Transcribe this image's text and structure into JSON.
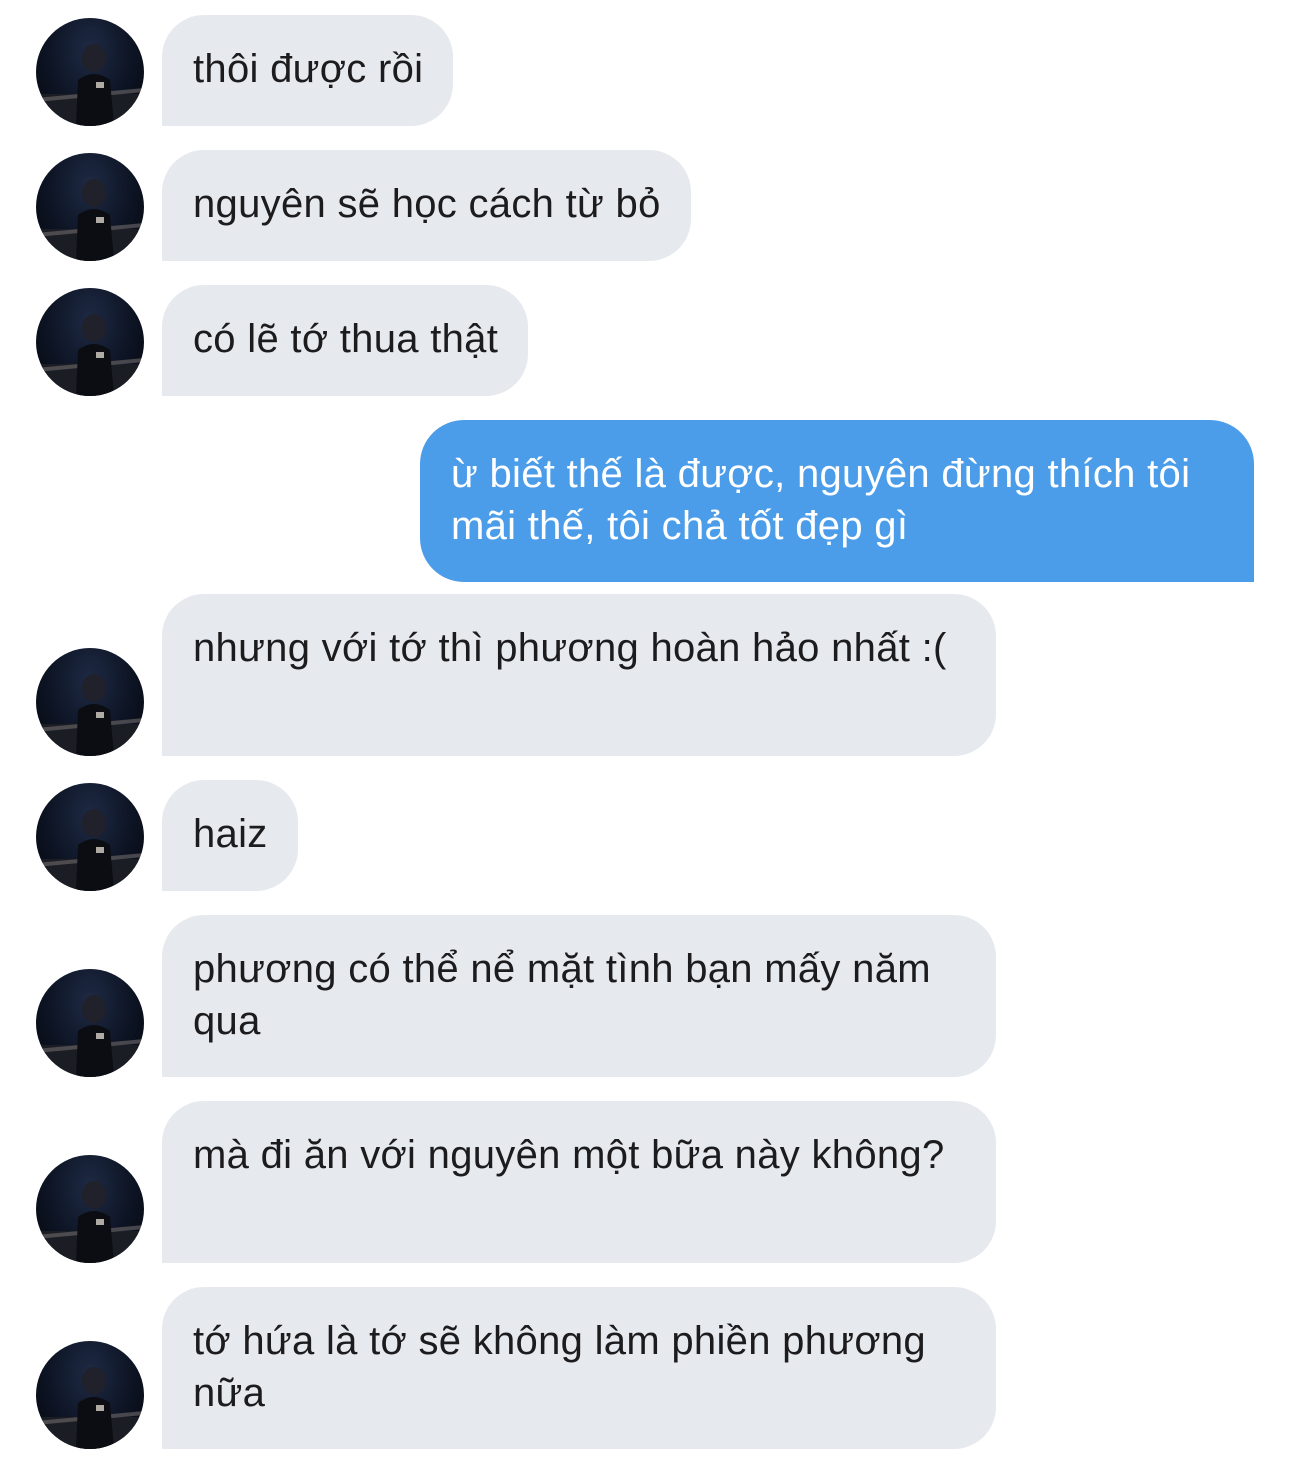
{
  "conversation": {
    "messages": [
      {
        "sender": "other",
        "text": "thôi được rồi"
      },
      {
        "sender": "other",
        "text": "nguyên sẽ học cách từ bỏ"
      },
      {
        "sender": "other",
        "text": "có lẽ tớ thua thật"
      },
      {
        "sender": "me",
        "text": "ừ biết thế là được, nguyên đừng thích tôi mãi thế, tôi chả tốt đẹp gì"
      },
      {
        "sender": "other",
        "text": "nhưng với tớ thì phương hoàn hảo nhất :("
      },
      {
        "sender": "other",
        "text": "haiz"
      },
      {
        "sender": "other",
        "text": "phương có thể nể mặt tình bạn mấy năm qua"
      },
      {
        "sender": "other",
        "text": "mà đi ăn với nguyên một bữa này không?"
      },
      {
        "sender": "other",
        "text": "tớ hứa là tớ sẽ không làm phiền phương nữa"
      }
    ]
  },
  "colors": {
    "incoming_bubble": "#e6e9ee",
    "outgoing_bubble": "#4c9de9",
    "incoming_text": "#1c1c1e",
    "outgoing_text": "#ffffff",
    "background": "#ffffff"
  },
  "icons": {
    "avatar": "contact-avatar-photo"
  }
}
